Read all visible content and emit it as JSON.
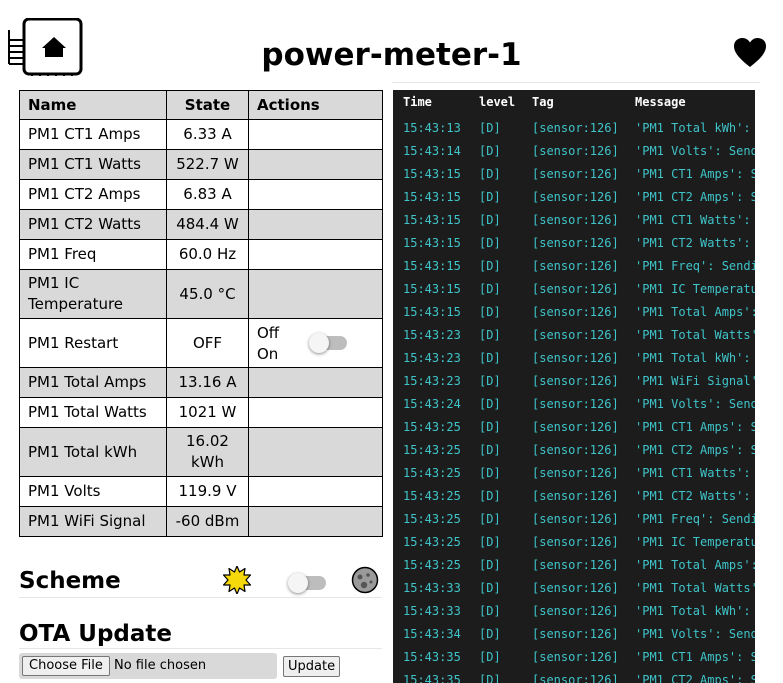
{
  "header": {
    "title": "power-meter-1"
  },
  "table": {
    "columns": [
      "Name",
      "State",
      "Actions"
    ],
    "rows": [
      {
        "name": "PM1 CT1 Amps",
        "state": "6.33 A"
      },
      {
        "name": "PM1 CT1 Watts",
        "state": "522.7 W"
      },
      {
        "name": "PM1 CT2 Amps",
        "state": "6.83 A"
      },
      {
        "name": "PM1 CT2 Watts",
        "state": "484.4 W"
      },
      {
        "name": "PM1 Freq",
        "state": "60.0 Hz"
      },
      {
        "name": "PM1 IC Temperature",
        "state": "45.0 °C"
      },
      {
        "name": "PM1 Restart",
        "state": "OFF",
        "action_off": "Off",
        "action_on": "On"
      },
      {
        "name": "PM1 Total Amps",
        "state": "13.16 A"
      },
      {
        "name": "PM1 Total Watts",
        "state": "1021 W"
      },
      {
        "name": "PM1 Total kWh",
        "state": "16.02 kWh"
      },
      {
        "name": "PM1 Volts",
        "state": "119.9 V"
      },
      {
        "name": "PM1 WiFi Signal",
        "state": "-60 dBm"
      }
    ]
  },
  "scheme": {
    "title": "Scheme"
  },
  "ota": {
    "title": "OTA Update",
    "choose_label": "Choose File",
    "no_file": "No file chosen",
    "update_label": "Update"
  },
  "log": {
    "headers": {
      "time": "Time",
      "level": "level",
      "tag": "Tag",
      "message": "Message"
    },
    "rows": [
      [
        "15:43:13",
        "[D]",
        "[sensor:126]",
        "'PM1 Total kWh': "
      ],
      [
        "15:43:14",
        "[D]",
        "[sensor:126]",
        "'PM1 Volts': Send"
      ],
      [
        "15:43:15",
        "[D]",
        "[sensor:126]",
        "'PM1 CT1 Amps': S"
      ],
      [
        "15:43:15",
        "[D]",
        "[sensor:126]",
        "'PM1 CT2 Amps': S"
      ],
      [
        "15:43:15",
        "[D]",
        "[sensor:126]",
        "'PM1 CT1 Watts': "
      ],
      [
        "15:43:15",
        "[D]",
        "[sensor:126]",
        "'PM1 CT2 Watts': "
      ],
      [
        "15:43:15",
        "[D]",
        "[sensor:126]",
        "'PM1 Freq': Sendi"
      ],
      [
        "15:43:15",
        "[D]",
        "[sensor:126]",
        "'PM1 IC Temperatu"
      ],
      [
        "15:43:15",
        "[D]",
        "[sensor:126]",
        "'PM1 Total Amps':"
      ],
      [
        "15:43:23",
        "[D]",
        "[sensor:126]",
        "'PM1 Total Watts'"
      ],
      [
        "15:43:23",
        "[D]",
        "[sensor:126]",
        "'PM1 Total kWh': "
      ],
      [
        "15:43:23",
        "[D]",
        "[sensor:126]",
        "'PM1 WiFi Signal'"
      ],
      [
        "15:43:24",
        "[D]",
        "[sensor:126]",
        "'PM1 Volts': Send"
      ],
      [
        "15:43:25",
        "[D]",
        "[sensor:126]",
        "'PM1 CT1 Amps': S"
      ],
      [
        "15:43:25",
        "[D]",
        "[sensor:126]",
        "'PM1 CT2 Amps': S"
      ],
      [
        "15:43:25",
        "[D]",
        "[sensor:126]",
        "'PM1 CT1 Watts': "
      ],
      [
        "15:43:25",
        "[D]",
        "[sensor:126]",
        "'PM1 CT2 Watts': "
      ],
      [
        "15:43:25",
        "[D]",
        "[sensor:126]",
        "'PM1 Freq': Sendi"
      ],
      [
        "15:43:25",
        "[D]",
        "[sensor:126]",
        "'PM1 IC Temperatu"
      ],
      [
        "15:43:25",
        "[D]",
        "[sensor:126]",
        "'PM1 Total Amps':"
      ],
      [
        "15:43:33",
        "[D]",
        "[sensor:126]",
        "'PM1 Total Watts'"
      ],
      [
        "15:43:33",
        "[D]",
        "[sensor:126]",
        "'PM1 Total kWh': "
      ],
      [
        "15:43:34",
        "[D]",
        "[sensor:126]",
        "'PM1 Volts': Send"
      ],
      [
        "15:43:35",
        "[D]",
        "[sensor:126]",
        "'PM1 CT1 Amps': S"
      ],
      [
        "15:43:35",
        "[D]",
        "[sensor:126]",
        "'PM1 CT2 Amps': S"
      ]
    ]
  },
  "icons": {
    "logo": "home-chip-icon",
    "heart": "heart-icon",
    "sun": "sun-icon",
    "moon": "moon-icon"
  },
  "colors": {
    "log_bg": "#1c1c1c",
    "log_text": "#3fc4c9",
    "row_alt": "#d9d9d9",
    "sun": "#f5d90a"
  },
  "restart_switch_on": false,
  "scheme_dark": false
}
